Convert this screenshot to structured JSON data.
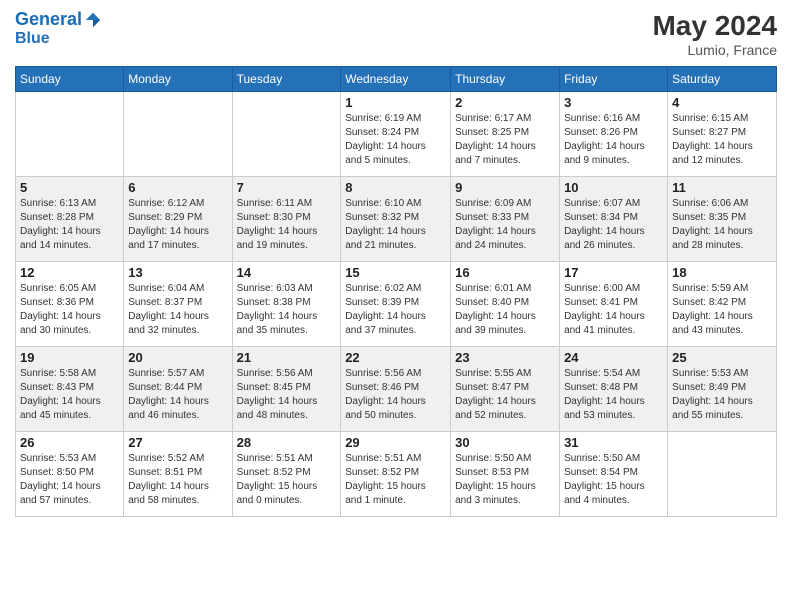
{
  "header": {
    "logo_line1": "General",
    "logo_line2": "Blue",
    "month_year": "May 2024",
    "location": "Lumio, France"
  },
  "weekdays": [
    "Sunday",
    "Monday",
    "Tuesday",
    "Wednesday",
    "Thursday",
    "Friday",
    "Saturday"
  ],
  "weeks": [
    [
      {
        "day": "",
        "info": ""
      },
      {
        "day": "",
        "info": ""
      },
      {
        "day": "",
        "info": ""
      },
      {
        "day": "1",
        "info": "Sunrise: 6:19 AM\nSunset: 8:24 PM\nDaylight: 14 hours\nand 5 minutes."
      },
      {
        "day": "2",
        "info": "Sunrise: 6:17 AM\nSunset: 8:25 PM\nDaylight: 14 hours\nand 7 minutes."
      },
      {
        "day": "3",
        "info": "Sunrise: 6:16 AM\nSunset: 8:26 PM\nDaylight: 14 hours\nand 9 minutes."
      },
      {
        "day": "4",
        "info": "Sunrise: 6:15 AM\nSunset: 8:27 PM\nDaylight: 14 hours\nand 12 minutes."
      }
    ],
    [
      {
        "day": "5",
        "info": "Sunrise: 6:13 AM\nSunset: 8:28 PM\nDaylight: 14 hours\nand 14 minutes."
      },
      {
        "day": "6",
        "info": "Sunrise: 6:12 AM\nSunset: 8:29 PM\nDaylight: 14 hours\nand 17 minutes."
      },
      {
        "day": "7",
        "info": "Sunrise: 6:11 AM\nSunset: 8:30 PM\nDaylight: 14 hours\nand 19 minutes."
      },
      {
        "day": "8",
        "info": "Sunrise: 6:10 AM\nSunset: 8:32 PM\nDaylight: 14 hours\nand 21 minutes."
      },
      {
        "day": "9",
        "info": "Sunrise: 6:09 AM\nSunset: 8:33 PM\nDaylight: 14 hours\nand 24 minutes."
      },
      {
        "day": "10",
        "info": "Sunrise: 6:07 AM\nSunset: 8:34 PM\nDaylight: 14 hours\nand 26 minutes."
      },
      {
        "day": "11",
        "info": "Sunrise: 6:06 AM\nSunset: 8:35 PM\nDaylight: 14 hours\nand 28 minutes."
      }
    ],
    [
      {
        "day": "12",
        "info": "Sunrise: 6:05 AM\nSunset: 8:36 PM\nDaylight: 14 hours\nand 30 minutes."
      },
      {
        "day": "13",
        "info": "Sunrise: 6:04 AM\nSunset: 8:37 PM\nDaylight: 14 hours\nand 32 minutes."
      },
      {
        "day": "14",
        "info": "Sunrise: 6:03 AM\nSunset: 8:38 PM\nDaylight: 14 hours\nand 35 minutes."
      },
      {
        "day": "15",
        "info": "Sunrise: 6:02 AM\nSunset: 8:39 PM\nDaylight: 14 hours\nand 37 minutes."
      },
      {
        "day": "16",
        "info": "Sunrise: 6:01 AM\nSunset: 8:40 PM\nDaylight: 14 hours\nand 39 minutes."
      },
      {
        "day": "17",
        "info": "Sunrise: 6:00 AM\nSunset: 8:41 PM\nDaylight: 14 hours\nand 41 minutes."
      },
      {
        "day": "18",
        "info": "Sunrise: 5:59 AM\nSunset: 8:42 PM\nDaylight: 14 hours\nand 43 minutes."
      }
    ],
    [
      {
        "day": "19",
        "info": "Sunrise: 5:58 AM\nSunset: 8:43 PM\nDaylight: 14 hours\nand 45 minutes."
      },
      {
        "day": "20",
        "info": "Sunrise: 5:57 AM\nSunset: 8:44 PM\nDaylight: 14 hours\nand 46 minutes."
      },
      {
        "day": "21",
        "info": "Sunrise: 5:56 AM\nSunset: 8:45 PM\nDaylight: 14 hours\nand 48 minutes."
      },
      {
        "day": "22",
        "info": "Sunrise: 5:56 AM\nSunset: 8:46 PM\nDaylight: 14 hours\nand 50 minutes."
      },
      {
        "day": "23",
        "info": "Sunrise: 5:55 AM\nSunset: 8:47 PM\nDaylight: 14 hours\nand 52 minutes."
      },
      {
        "day": "24",
        "info": "Sunrise: 5:54 AM\nSunset: 8:48 PM\nDaylight: 14 hours\nand 53 minutes."
      },
      {
        "day": "25",
        "info": "Sunrise: 5:53 AM\nSunset: 8:49 PM\nDaylight: 14 hours\nand 55 minutes."
      }
    ],
    [
      {
        "day": "26",
        "info": "Sunrise: 5:53 AM\nSunset: 8:50 PM\nDaylight: 14 hours\nand 57 minutes."
      },
      {
        "day": "27",
        "info": "Sunrise: 5:52 AM\nSunset: 8:51 PM\nDaylight: 14 hours\nand 58 minutes."
      },
      {
        "day": "28",
        "info": "Sunrise: 5:51 AM\nSunset: 8:52 PM\nDaylight: 15 hours\nand 0 minutes."
      },
      {
        "day": "29",
        "info": "Sunrise: 5:51 AM\nSunset: 8:52 PM\nDaylight: 15 hours\nand 1 minute."
      },
      {
        "day": "30",
        "info": "Sunrise: 5:50 AM\nSunset: 8:53 PM\nDaylight: 15 hours\nand 3 minutes."
      },
      {
        "day": "31",
        "info": "Sunrise: 5:50 AM\nSunset: 8:54 PM\nDaylight: 15 hours\nand 4 minutes."
      },
      {
        "day": "",
        "info": ""
      }
    ]
  ]
}
